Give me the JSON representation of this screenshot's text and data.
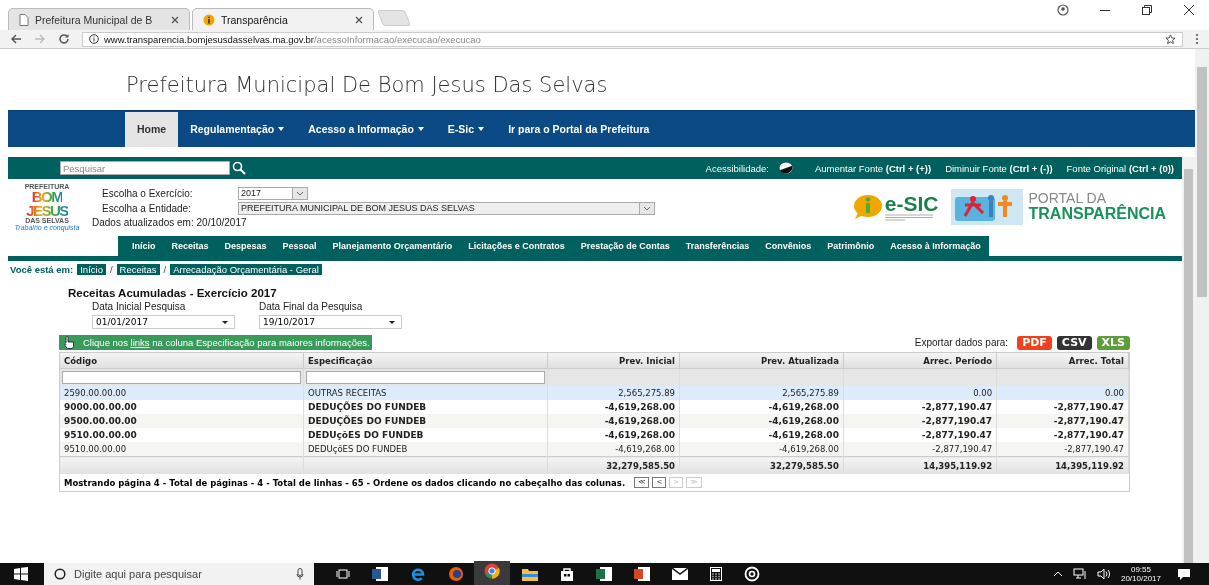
{
  "browser": {
    "tabs": [
      {
        "title": "Prefeitura Municipal de B",
        "selected": false,
        "kind": "page"
      },
      {
        "title": "Transparência",
        "selected": true,
        "kind": "info"
      }
    ],
    "url": {
      "host": "www.transparencia.bomjesusdasselvas.ma.gov.br",
      "path": "/acessoInformacao/execucao/execucao"
    }
  },
  "site": {
    "title": "Prefeitura Municipal De Bom Jesus Das Selvas",
    "nav": [
      {
        "label": "Home",
        "dropdown": false,
        "selected": true
      },
      {
        "label": "Regulamentação",
        "dropdown": true,
        "selected": false
      },
      {
        "label": "Acesso a Informação",
        "dropdown": true,
        "selected": false
      },
      {
        "label": "E-Sic",
        "dropdown": true,
        "selected": false
      },
      {
        "label": "Ir para o Portal da Prefeitura",
        "dropdown": false,
        "selected": false
      }
    ]
  },
  "portal": {
    "search": {
      "placeholder": "Pesquisar"
    },
    "accessibility_label": "Acessibilidade:",
    "font_links": [
      "Aumentar Fonte **(Ctrl + (+))**",
      "Diminuir Fonte **(Ctrl + (-))**",
      "Fonte Original **(Ctrl + (0))**"
    ],
    "logo": {
      "top": "PREFEITURA",
      "line1": "BOM",
      "line2": "JESUS",
      "bottom": "DAS SELVAS",
      "tagline": "Trabalho e conquista"
    },
    "exercise": {
      "label": "Escolha o Exercício:",
      "value": "2017"
    },
    "entity": {
      "label": "Escolha a Entidade:",
      "value": "PREFEITURA MUNICIPAL DE BOM JESUS DAS SELVAS"
    },
    "updated": "Dados atualizados em: 20/10/2017",
    "esic": "e-SIC",
    "portal_logo": {
      "line1": "PORTAL DA",
      "line2": "TRANSPARÊNCIA"
    },
    "menu": [
      "Início",
      "Receitas",
      "Despesas",
      "Pessoal",
      "Planejamento Orçamentário",
      "Licitações e Contratos",
      "Prestação de Contas",
      "Transferências",
      "Convênios",
      "Patrimônio",
      "Acesso à Informação"
    ],
    "breadcrumb": {
      "label": "Você está em:",
      "items": [
        {
          "kind": "link",
          "label": "Início"
        },
        {
          "kind": "separator",
          "label": "/"
        },
        {
          "kind": "link",
          "label": "Receitas"
        },
        {
          "kind": "separator",
          "label": "/"
        },
        {
          "kind": "link",
          "label": "Arrecadação Orçamentária - Geral"
        }
      ]
    }
  },
  "report": {
    "title": "Receitas Acumuladas - Exercício 2017",
    "dates": [
      {
        "label": "Data Inicial Pesquisa",
        "value": "01/01/2017"
      },
      {
        "label": "Data Final da Pesquisa",
        "value": "19/10/2017"
      }
    ],
    "hint": {
      "before": "Clique nos ",
      "link": "links",
      "after": " na coluna Especificação para maiores informações."
    },
    "export_label": "Exportar dados para:",
    "exports": [
      {
        "label": "PDF",
        "color": "#f0401c"
      },
      {
        "label": "CSV",
        "color": "#333333"
      },
      {
        "label": "XLS",
        "color": "#5c9e3a"
      }
    ],
    "columns": [
      {
        "label": "Código",
        "filter": true
      },
      {
        "label": "Especificação",
        "filter": true
      },
      {
        "label": "Prev. Inicial",
        "filter": false
      },
      {
        "label": "Prev. Atualizada",
        "filter": false
      },
      {
        "label": "Arrec. Período",
        "filter": false
      },
      {
        "label": "Arrec. Total",
        "filter": false
      }
    ],
    "rows": [
      {
        "cells": [
          "2590.00.00.00",
          "OUTRAS RECEITAS",
          "2,565,275.89",
          "2,565,275.89",
          "0.00",
          "0.00"
        ],
        "bold": false,
        "selected": true
      },
      {
        "cells": [
          "9000.00.00.00",
          "DEDUÇÕES DO FUNDEB",
          "-4,619,268.00",
          "-4,619,268.00",
          "-2,877,190.47",
          "-2,877,190.47"
        ],
        "bold": true,
        "selected": false
      },
      {
        "cells": [
          "9500.00.00.00",
          "DEDUÇÕES DO FUNDEB",
          "-4,619,268.00",
          "-4,619,268.00",
          "-2,877,190.47",
          "-2,877,190.47"
        ],
        "bold": true,
        "selected": false
      },
      {
        "cells": [
          "9510.00.00.00",
          "DEDUçõES DO FUNDEB",
          "-4,619,268.00",
          "-4,619,268.00",
          "-2,877,190.47",
          "-2,877,190.47"
        ],
        "bold": true,
        "selected": false
      },
      {
        "cells": [
          "9510.00.00.00",
          "DEDUçõES DO FUNDEB",
          "-4,619,268.00",
          "-4,619,268.00",
          "-2,877,190.47",
          "-2,877,190.47"
        ],
        "bold": false,
        "selected": false
      }
    ],
    "totals": [
      "32,279,585.50",
      "32,279,585.50",
      "14,395,119.92",
      "14,395,119.92"
    ],
    "footer": "Mostrando página 4 - Total de páginas - 4 - Total de linhas - 65 - Ordene os dados clicando no cabeçalho das colunas.",
    "pager": [
      {
        "label": "≪",
        "disabled": false
      },
      {
        "label": "<",
        "disabled": false
      },
      {
        "label": ">",
        "disabled": true
      },
      {
        "label": "≫",
        "disabled": true
      }
    ]
  },
  "taskbar": {
    "search": {
      "placeholder": "Digite aqui para pesquisar"
    },
    "time": "09:55",
    "date": "20/10/2017"
  }
}
